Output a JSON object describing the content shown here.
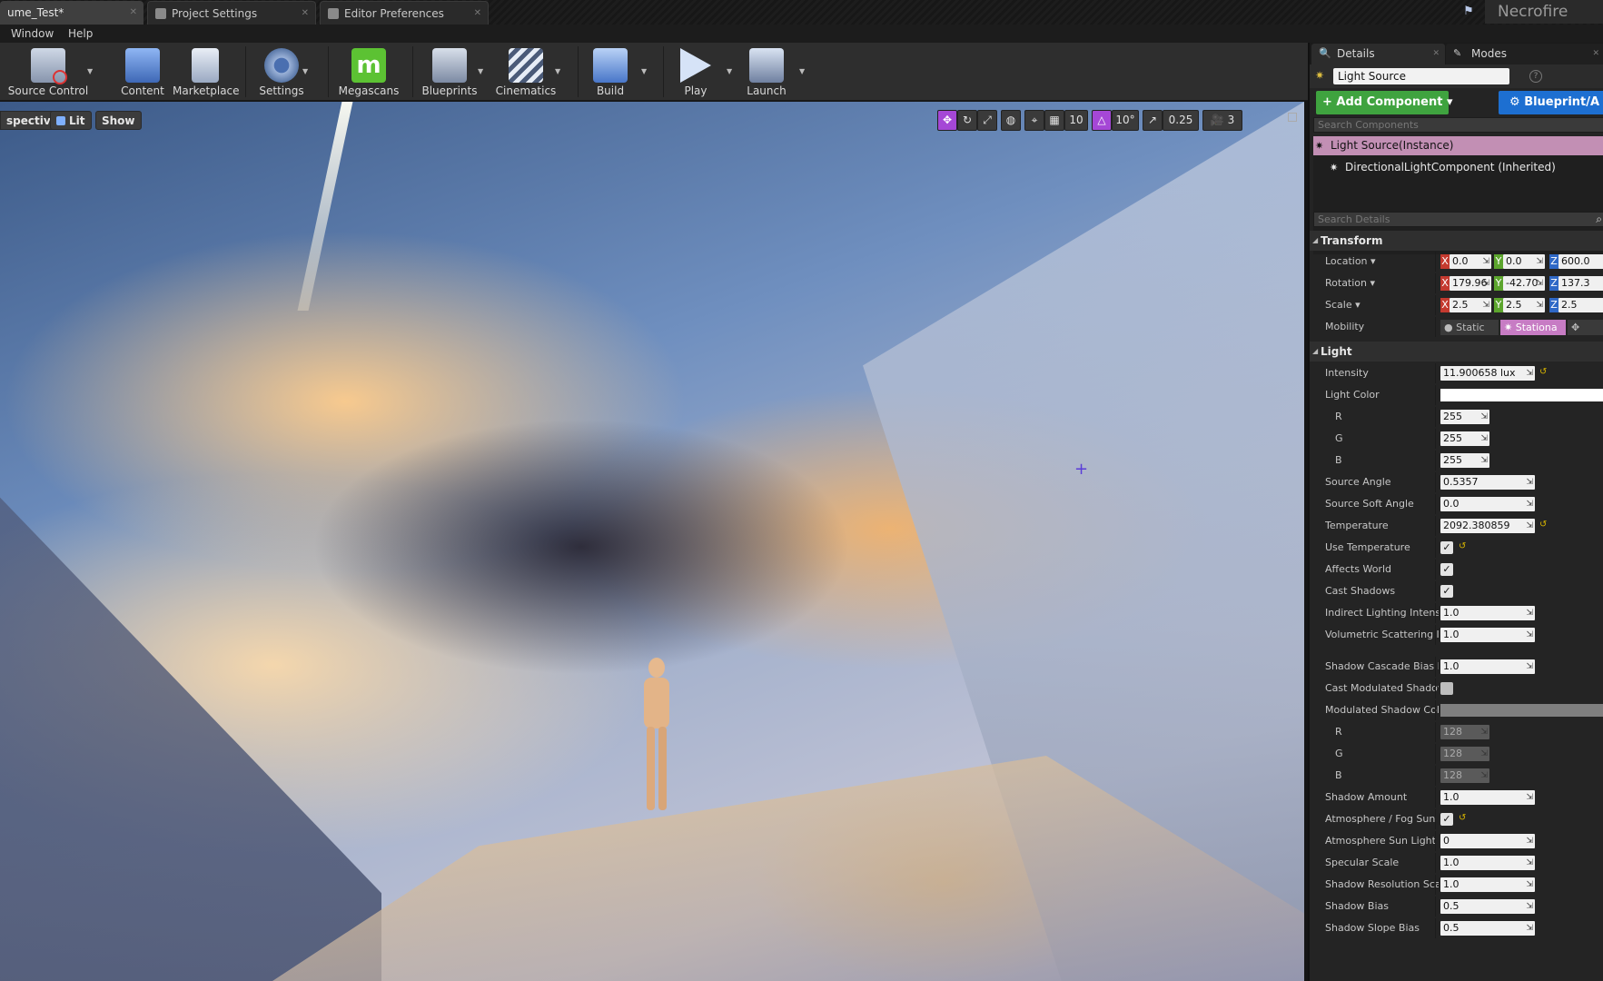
{
  "tabs": [
    {
      "label": "ume_Test*",
      "active": true
    },
    {
      "label": "Project Settings",
      "active": false
    },
    {
      "label": "Editor Preferences",
      "active": false
    }
  ],
  "project_name": "Necrofire",
  "menu": [
    "Window",
    "Help"
  ],
  "toolbar": {
    "source_control": "Source Control",
    "content": "Content",
    "marketplace": "Marketplace",
    "settings": "Settings",
    "megascans": "Megascans",
    "blueprints": "Blueprints",
    "cinematics": "Cinematics",
    "build": "Build",
    "play": "Play",
    "launch": "Launch"
  },
  "viewport": {
    "perspective_label": "spective",
    "lit_label": "Lit",
    "show_label": "Show",
    "grid_snap": "10",
    "rotation_snap": "10°",
    "scale_snap": "0.25",
    "camera_speed": "3"
  },
  "details": {
    "tab_details": "Details",
    "tab_modes": "Modes",
    "actor_name": "Light Source",
    "add_component": "+ Add Component ▾",
    "blueprint": "Blueprint/A",
    "search_components": "Search Components",
    "components": [
      "Light Source(Instance)",
      "DirectionalLightComponent (Inherited)"
    ],
    "search_details": "Search Details",
    "transform": {
      "header": "Transform",
      "location_label": "Location ▾",
      "location": [
        "0.0",
        "0.0",
        "600.0"
      ],
      "rotation_label": "Rotation ▾",
      "rotation": [
        "179.96",
        "-42.70",
        "137.3"
      ],
      "scale_label": "Scale ▾",
      "scale": [
        "2.5",
        "2.5",
        "2.5"
      ],
      "mobility_label": "Mobility",
      "mobility_static": "Static",
      "mobility_stationary": "Stationa"
    },
    "light": {
      "header": "Light",
      "intensity_label": "Intensity",
      "intensity": "11.900658 lux",
      "light_color_label": "Light Color",
      "r_label": "R",
      "r": "255",
      "g_label": "G",
      "g": "255",
      "b_label": "B",
      "b": "255",
      "source_angle_label": "Source Angle",
      "source_angle": "0.5357",
      "source_soft_angle_label": "Source Soft Angle",
      "source_soft_angle": "0.0",
      "temperature_label": "Temperature",
      "temperature": "2092.380859",
      "use_temperature_label": "Use Temperature",
      "affects_world_label": "Affects World",
      "cast_shadows_label": "Cast Shadows",
      "indirect_label": "Indirect Lighting Intensi",
      "indirect": "1.0",
      "volumetric_label": "Volumetric Scattering I",
      "volumetric": "1.0",
      "cascade_bias_label": "Shadow Cascade Bias D",
      "cascade_bias": "1.0",
      "cast_modulated_label": "Cast Modulated Shadov",
      "modulated_color_label": "Modulated Shadow Col",
      "mr_label": "R",
      "mr": "128",
      "mg_label": "G",
      "mg": "128",
      "mb_label": "B",
      "mb": "128",
      "shadow_amount_label": "Shadow Amount",
      "shadow_amount": "1.0",
      "atmo_fog_label": "Atmosphere / Fog Sun I",
      "atmo_sun_label": "Atmosphere Sun Light I",
      "atmo_sun": "0",
      "specular_label": "Specular Scale",
      "specular": "1.0",
      "shadow_res_label": "Shadow Resolution Sca",
      "shadow_res": "1.0",
      "shadow_bias_label": "Shadow Bias",
      "shadow_bias": "0.5",
      "shadow_slope_label": "Shadow Slope Bias",
      "shadow_slope": "0.5"
    }
  },
  "colors": {
    "add_component": "#3fa33f",
    "blueprint": "#1d6fd1",
    "selection": "#c28fb4",
    "snap_active": "#a547d6"
  }
}
